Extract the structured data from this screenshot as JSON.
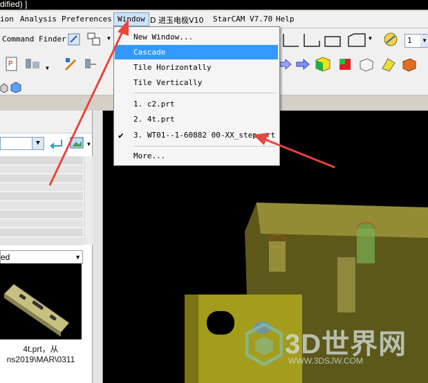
{
  "window": {
    "title_fragment": "dified) ]"
  },
  "menubar": {
    "items": [
      {
        "label": "ion"
      },
      {
        "label": "Analysis"
      },
      {
        "label": "Preferences"
      },
      {
        "label": "Window"
      },
      {
        "label": "D 进玉电极V10"
      },
      {
        "label": "StarCAM V7.70"
      },
      {
        "label": "Help"
      }
    ]
  },
  "toolbar": {
    "command_finder_label": "Command Finder",
    "spinner_value": "1"
  },
  "window_menu": {
    "items": [
      {
        "label": "New Window..."
      },
      {
        "label": "Cascade"
      },
      {
        "label": "Tile Horizontally"
      },
      {
        "label": "Tile Vertically"
      }
    ],
    "recent": [
      {
        "label": "1.  c2.prt"
      },
      {
        "label": "2.  4t.prt"
      },
      {
        "label": "3.  WT01--1-60882 00-XX_step.prt"
      }
    ],
    "more_label": "More..."
  },
  "left_panel": {
    "filter_value": "ed",
    "caption_line1": "4t.prt，从",
    "caption_line2": "ns2019\\MAR\\0311"
  },
  "watermark": {
    "text": "3D世界网",
    "url": "WWW.3DSJW.COM"
  },
  "colors": {
    "highlight": "#3399ff",
    "arrow": "#e8453c",
    "viewport": "#000000",
    "part": "#a8a030"
  }
}
